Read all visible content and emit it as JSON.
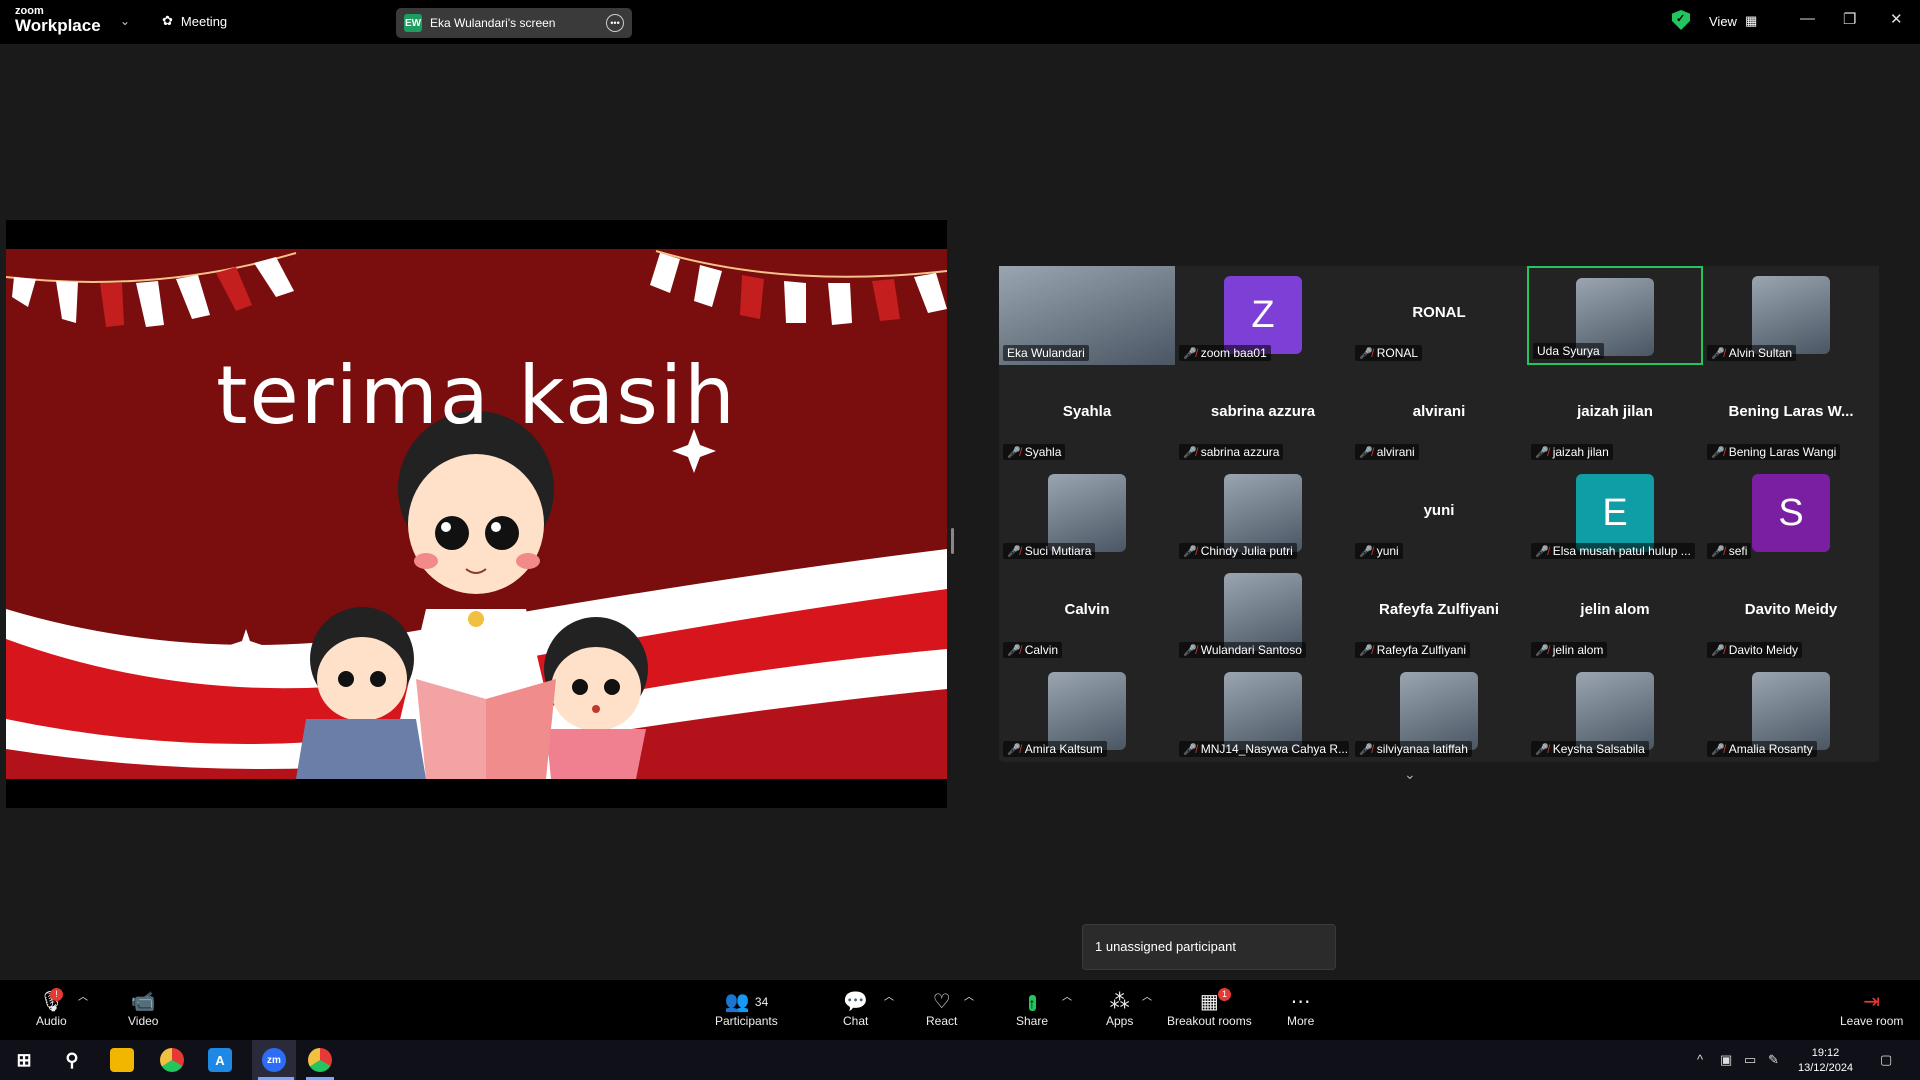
{
  "app": {
    "logo_top": "zoom",
    "logo_bottom": "Workplace",
    "meeting_label": "Meeting",
    "screen_badge": "EW",
    "screen_label": "Eka Wulandari's screen",
    "view_label": "View"
  },
  "slide": {
    "title": "terima kasih"
  },
  "gallery": {
    "tiles": [
      {
        "label": "Eka Wulandari",
        "type": "photo",
        "muted": false
      },
      {
        "label": "zoom baa01",
        "type": "letter",
        "letter": "Z",
        "color": "#7e3fd6",
        "muted": true
      },
      {
        "label": "RONAL",
        "type": "name",
        "big": "RONAL",
        "muted": true
      },
      {
        "label": "Uda Syurya",
        "type": "photo",
        "muted": false,
        "active": true
      },
      {
        "label": "Alvin Sultan",
        "type": "photo",
        "muted": true
      },
      {
        "label": "Syahla",
        "type": "name",
        "big": "Syahla",
        "muted": true
      },
      {
        "label": "sabrina azzura",
        "type": "name",
        "big": "sabrina azzura",
        "muted": true
      },
      {
        "label": "alvirani",
        "type": "name",
        "big": "alvirani",
        "muted": true
      },
      {
        "label": "jaizah jilan",
        "type": "name",
        "big": "jaizah jilan",
        "muted": true
      },
      {
        "label": "Bening Laras Wangi",
        "type": "name",
        "big": "Bening Laras W...",
        "muted": true
      },
      {
        "label": "Suci Mutiara",
        "type": "photo",
        "muted": true
      },
      {
        "label": "Chindy Julia putri",
        "type": "photo",
        "muted": true
      },
      {
        "label": "yuni",
        "type": "name",
        "big": "yuni",
        "muted": true
      },
      {
        "label": "Elsa musah patul hulup ...",
        "type": "letter",
        "letter": "E",
        "color": "#0f9ea6",
        "muted": true
      },
      {
        "label": "sefi",
        "type": "letter",
        "letter": "S",
        "color": "#7b1fa2",
        "muted": true
      },
      {
        "label": "Calvin",
        "type": "name",
        "big": "Calvin",
        "muted": true
      },
      {
        "label": "Wulandari Santoso",
        "type": "photo",
        "muted": true
      },
      {
        "label": "Rafeyfa Zulfiyani",
        "type": "name",
        "big": "Rafeyfa Zulfiyani",
        "muted": true
      },
      {
        "label": "jelin alom",
        "type": "name",
        "big": "jelin alom",
        "muted": true
      },
      {
        "label": "Davito Meidy",
        "type": "name",
        "big": "Davito Meidy",
        "muted": true
      },
      {
        "label": "Amira Kaltsum",
        "type": "photo",
        "muted": true
      },
      {
        "label": "MNJ14_Nasywa Cahya R...",
        "type": "photo",
        "muted": true
      },
      {
        "label": "silviyanaa latiffah",
        "type": "photo",
        "muted": true
      },
      {
        "label": "Keysha Salsabila",
        "type": "photo",
        "muted": true
      },
      {
        "label": "Amalia Rosanty",
        "type": "photo",
        "muted": true
      }
    ]
  },
  "toast": {
    "text": "1 unassigned participant"
  },
  "toolbar": {
    "audio": "Audio",
    "video": "Video",
    "participants": "Participants",
    "participants_count": "34",
    "chat": "Chat",
    "react": "React",
    "share": "Share",
    "apps": "Apps",
    "breakout": "Breakout rooms",
    "breakout_badge": "1",
    "audio_badge": "!",
    "more": "More",
    "leave": "Leave room"
  },
  "taskbar": {
    "time": "19:12",
    "date": "13/12/2024",
    "zoom_label": "zm"
  },
  "colors": {
    "accent_green": "#22c55e",
    "slide_red": "#7a0d0d",
    "mute_red": "#e53935"
  }
}
